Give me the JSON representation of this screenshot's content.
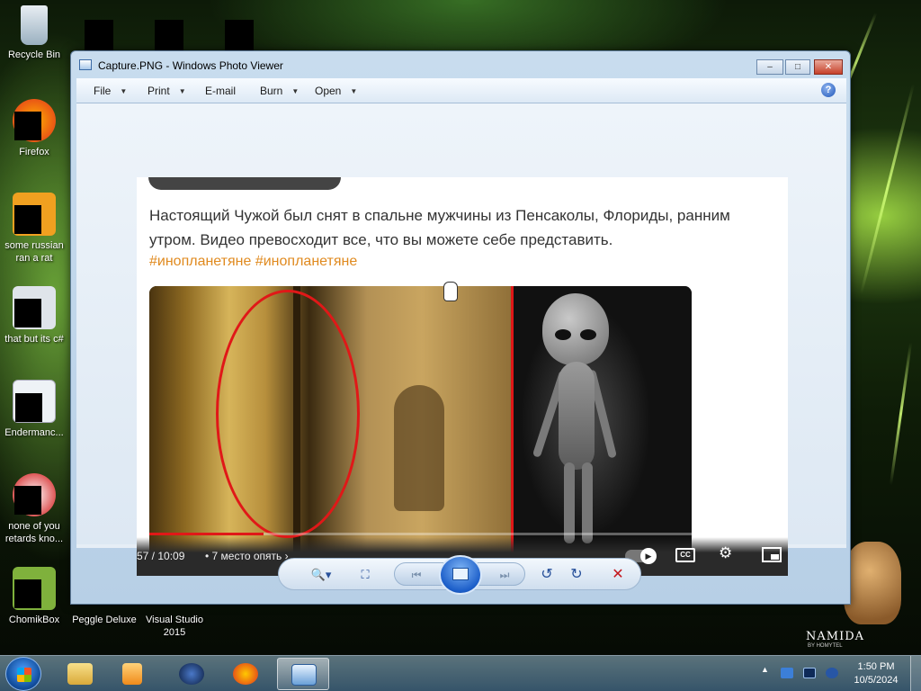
{
  "desktop": {
    "icons": [
      {
        "label": "Recycle Bin"
      },
      {
        "label": "Firefox"
      },
      {
        "label": "some russian ran a rat"
      },
      {
        "label": "that but its c#"
      },
      {
        "label": "Endermanc..."
      },
      {
        "label": "none of you retards kno..."
      },
      {
        "label": "ChomikBox"
      },
      {
        "label": "Peggle Deluxe"
      },
      {
        "label": "Visual Studio 2015"
      }
    ]
  },
  "window": {
    "title": "Capture.PNG - Windows Photo Viewer",
    "controls": {
      "minimize": "–",
      "maximize": "□",
      "close": "✕"
    },
    "menu": {
      "file": "File",
      "print": "Print",
      "email": "E-mail",
      "burn": "Burn",
      "open": "Open",
      "help": "?"
    },
    "toolbar": {
      "zoom": "🔍▾",
      "actual_size": "⛶",
      "previous": "⏮",
      "next": "⏭",
      "rotate_ccw": "↺",
      "rotate_cw": "↻",
      "delete": "✕"
    }
  },
  "capture": {
    "post_text": "Настоящий Чужой был снят в спальне мужчины из Пенсаколы, Флориды, ранним утром. Видео превосходит все, что вы можете себе представить.",
    "hashtags": "#инопланетяне #инопланетяне",
    "video": {
      "time": "57 / 10:09",
      "chapter": "• 7 место опять ›",
      "progress_fraction": 0.21,
      "cc_label": "CC",
      "settings_icon": "⚙"
    }
  },
  "taskbar": {
    "clock_time": "1:50 PM",
    "clock_date": "10/5/2024",
    "tray_arrow": "▲"
  },
  "wallpaper": {
    "brand": "NAMIDA",
    "sub": "BY HOMYTEL"
  },
  "colors": {
    "accent_red": "#e01818",
    "hashtag_orange": "#e08a1f"
  }
}
